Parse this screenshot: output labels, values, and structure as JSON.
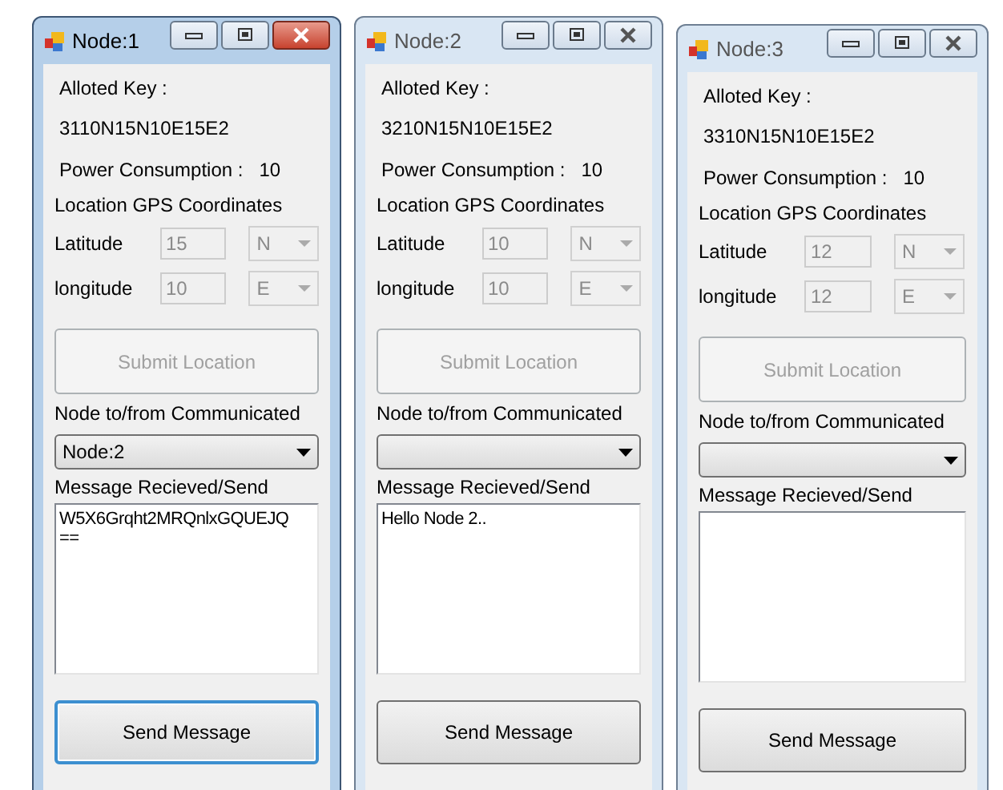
{
  "windows": [
    {
      "title": "Node:1",
      "active": true,
      "key_label": "Alloted Key :",
      "key": "3110N15N10E15E2",
      "power_label": "Power Consumption :",
      "power_value": "10",
      "gps_label": "Location GPS Coordinates",
      "coords": [
        {
          "label": "Latitude",
          "value": "15",
          "direction": "N",
          "disabled": true
        },
        {
          "label": "longitude",
          "value": "10",
          "direction": "E",
          "disabled": true
        }
      ],
      "submit": {
        "label": "Submit Location",
        "disabled": true
      },
      "node_label": "Node to/from Communicated",
      "node_value": "Node:2",
      "message_label": "Message Recieved/Send",
      "message": "W5X6Grqht2MRQnlxGQUEJQ\n==",
      "send": {
        "label": "Send Message",
        "focused": true
      }
    },
    {
      "title": "Node:2",
      "active": false,
      "key_label": "Alloted Key :",
      "key": "3210N15N10E15E2",
      "power_label": "Power Consumption :",
      "power_value": "10",
      "gps_label": "Location GPS Coordinates",
      "coords": [
        {
          "label": "Latitude",
          "value": "10",
          "direction": "N",
          "disabled": true
        },
        {
          "label": "longitude",
          "value": "10",
          "direction": "E",
          "disabled": true
        }
      ],
      "submit": {
        "label": "Submit Location",
        "disabled": true
      },
      "node_label": "Node to/from Communicated",
      "message_label": "Message Recieved/Send",
      "message": "Hello Node 2..",
      "send": {
        "label": "Send Message",
        "focused": false
      }
    },
    {
      "title": "Node:3",
      "active": false,
      "key_label": "Alloted Key :",
      "key": "3310N15N10E15E2",
      "power_label": "Power Consumption :",
      "power_value": "10",
      "gps_label": "Location GPS Coordinates",
      "coords": [
        {
          "label": "Latitude",
          "value": "12",
          "direction": "N",
          "disabled": true
        },
        {
          "label": "longitude",
          "value": "12",
          "direction": "E",
          "disabled": true
        }
      ],
      "submit": {
        "label": "Submit Location",
        "disabled": true
      },
      "node_label": "Node to/from Communicated",
      "message_label": "Message Recieved/Send",
      "send": {
        "label": "Send Message",
        "focused": false
      }
    }
  ]
}
